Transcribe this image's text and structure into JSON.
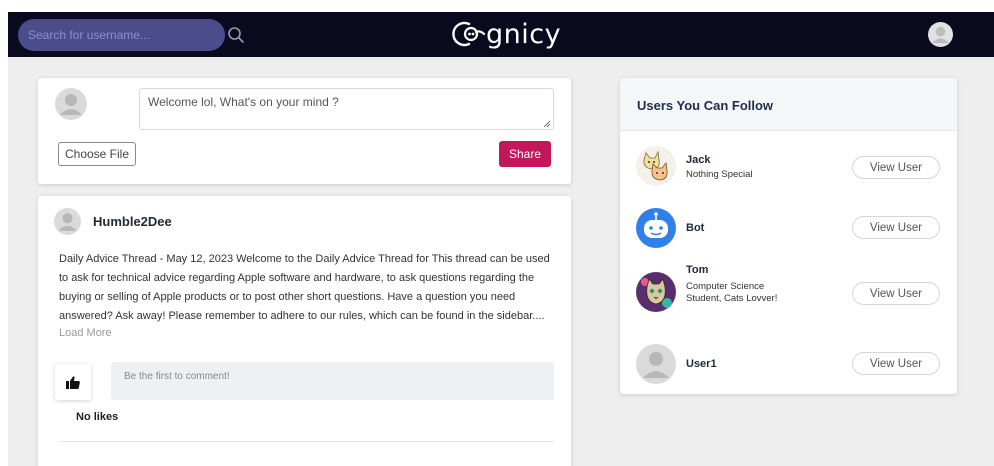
{
  "navbar": {
    "search_placeholder": "Search for username...",
    "logo_text": "gnicy",
    "colors": {
      "background": "#0a0a1e",
      "search_bg": "#4b4c8b"
    }
  },
  "composer": {
    "placeholder": "Welcome lol, What's on your mind ?",
    "choose_file_label": "Choose File",
    "share_label": "Share",
    "share_color": "#c2185b"
  },
  "post": {
    "author": "Humble2Dee",
    "body": "Daily Advice Thread - May 12, 2023 Welcome to the Daily Advice Thread for This thread can be used to ask for technical advice regarding Apple software and hardware, to ask questions regarding the buying or selling of Apple products or to post other short questions. Have a question you need answered? Ask away! Please remember to adhere to our rules, which can be found in the sidebar....",
    "load_more": "Load More",
    "comment_placeholder": "Be the first to comment!",
    "likes_text": "No likes",
    "like_icon": "thumbs-up-icon"
  },
  "follow": {
    "title": "Users You Can Follow",
    "users": [
      {
        "name": "Jack",
        "bio": "Nothing Special",
        "button": "View User",
        "avatar": "cats-avatar"
      },
      {
        "name": "Bot",
        "bio": "",
        "button": "View User",
        "avatar": "robot-avatar"
      },
      {
        "name": "Tom",
        "bio": "Computer Science Student, Cats Lovver!",
        "button": "View User",
        "avatar": "cat-art-avatar"
      },
      {
        "name": "User1",
        "bio": "",
        "button": "View User",
        "avatar": "default-avatar"
      }
    ]
  }
}
